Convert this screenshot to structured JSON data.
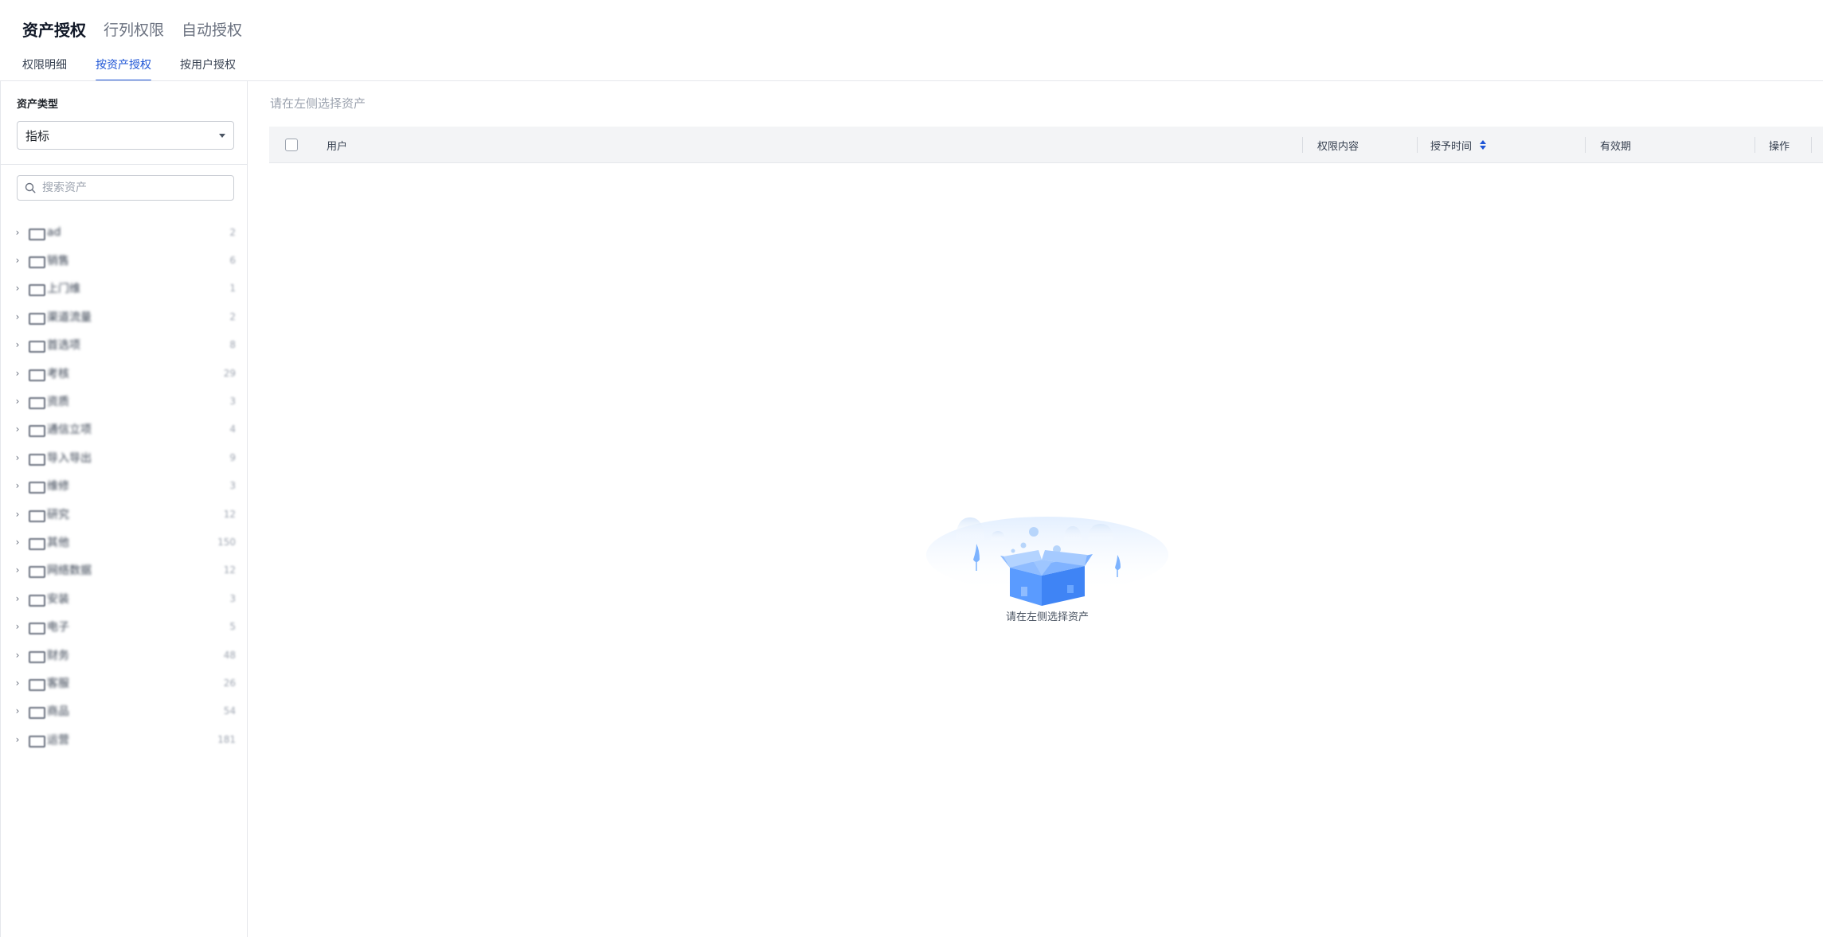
{
  "top_tabs": [
    {
      "label": "资产授权",
      "active": true
    },
    {
      "label": "行列权限",
      "active": false
    },
    {
      "label": "自动授权",
      "active": false
    }
  ],
  "sub_tabs": [
    {
      "label": "权限明细",
      "active": false
    },
    {
      "label": "按资产授权",
      "active": true
    },
    {
      "label": "按用户授权",
      "active": false
    }
  ],
  "sidebar": {
    "asset_type_label": "资产类型",
    "asset_type_value": "指标",
    "search_placeholder": "搜索资产",
    "tree_items": [
      {
        "label": "ad",
        "count": "2"
      },
      {
        "label": "销售",
        "count": "6"
      },
      {
        "label": "上门维",
        "count": "1"
      },
      {
        "label": "渠道流量",
        "count": "2"
      },
      {
        "label": "首选项",
        "count": "8"
      },
      {
        "label": "考核",
        "count": "29"
      },
      {
        "label": "资质",
        "count": "3"
      },
      {
        "label": "通信立项",
        "count": "4"
      },
      {
        "label": "导入导出",
        "count": "9"
      },
      {
        "label": "维修",
        "count": "3"
      },
      {
        "label": "研究",
        "count": "12"
      },
      {
        "label": "其他",
        "count": "150"
      },
      {
        "label": "网络数据",
        "count": "12"
      },
      {
        "label": "安装",
        "count": "3"
      },
      {
        "label": "电子",
        "count": "5"
      },
      {
        "label": "财务",
        "count": "48"
      },
      {
        "label": "客服",
        "count": "26"
      },
      {
        "label": "商品",
        "count": "54"
      },
      {
        "label": "运营",
        "count": "181"
      }
    ]
  },
  "main": {
    "hint": "请在左侧选择资产",
    "columns": {
      "user": "用户",
      "content": "权限内容",
      "grant_time": "授予时间",
      "validity": "有效期",
      "action": "操作"
    },
    "empty_text": "请在左侧选择资产"
  },
  "colors": {
    "accent": "#1e55d6",
    "box": "#6aa6ff"
  }
}
